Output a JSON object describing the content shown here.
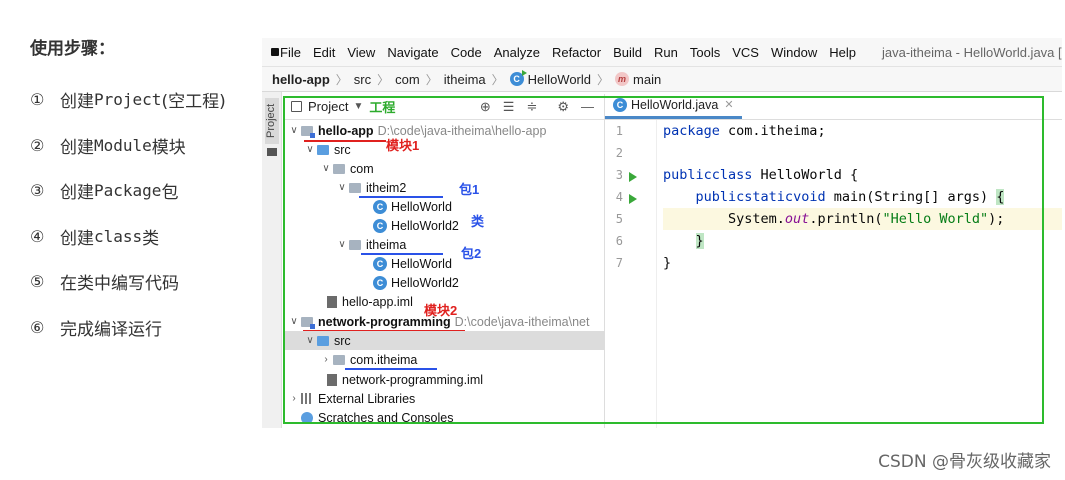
{
  "notes": {
    "title": "使用步骤：",
    "steps": [
      {
        "num": "①",
        "pre": "创建",
        "code": "Project",
        "post": " (空工程)"
      },
      {
        "num": "②",
        "pre": "创建",
        "code": "Module",
        "post": "模块"
      },
      {
        "num": "③",
        "pre": "创建",
        "code": "Package",
        "post": "包"
      },
      {
        "num": "④",
        "pre": "创建",
        "code": "class",
        "post": " 类"
      },
      {
        "num": "⑤",
        "pre": "在类中编写代码",
        "code": "",
        "post": ""
      },
      {
        "num": "⑥",
        "pre": "完成编译运行",
        "code": "",
        "post": ""
      }
    ]
  },
  "menu": {
    "items": [
      "File",
      "Edit",
      "View",
      "Navigate",
      "Code",
      "Analyze",
      "Refactor",
      "Build",
      "Run",
      "Tools",
      "VCS",
      "Window",
      "Help"
    ],
    "window_title": "java-itheima - HelloWorld.java [h"
  },
  "breadcrumb": [
    "hello-app",
    "src",
    "com",
    "itheima",
    "HelloWorld",
    "main"
  ],
  "project_panel": {
    "title": "Project",
    "annotation": "工程",
    "rows": [
      {
        "label": "hello-app",
        "path": "D:\\code\\java-itheima\\hello-app"
      },
      {
        "label": "src"
      },
      {
        "label": "com"
      },
      {
        "label": "itheim2"
      },
      {
        "label": "HelloWorld"
      },
      {
        "label": "HelloWorld2"
      },
      {
        "label": "itheima"
      },
      {
        "label": "HelloWorld"
      },
      {
        "label": "HelloWorld2"
      },
      {
        "label": "hello-app.iml"
      },
      {
        "label": "network-programming",
        "path": "D:\\code\\java-itheima\\net"
      },
      {
        "label": "src"
      },
      {
        "label": "com.itheima"
      },
      {
        "label": "network-programming.iml"
      },
      {
        "label": "External Libraries"
      },
      {
        "label": "Scratches and Consoles"
      }
    ],
    "annotations": {
      "module1": "模块1",
      "package1": "包1",
      "class": "类",
      "package2": "包2",
      "module2": "模块2"
    }
  },
  "editor": {
    "tab": "HelloWorld.java",
    "line_numbers": [
      "1",
      "2",
      "3",
      "4",
      "5",
      "6",
      "7"
    ],
    "code": {
      "l1_kw": "package",
      "l1_rest": " com.itheima;",
      "l3_kw1": "public",
      "l3_kw2": "class",
      "l3_rest": " HelloWorld {",
      "l4_indent": "    ",
      "l4_kw1": "public",
      "l4_kw2": "static",
      "l4_kw3": "void",
      "l4_rest": " main(String[] args) ",
      "l4_brace": "{",
      "l5_pre": "        System.",
      "l5_out": "out",
      "l5_mid": ".println(",
      "l5_str": "\"Hello World\"",
      "l5_post": ");",
      "l6_indent": "    ",
      "l6_brace": "}",
      "l7": "}"
    }
  },
  "watermark": "CSDN @骨灰级收藏家",
  "colors": {
    "frame_green": "#2dbb2d",
    "annotation_red": "#e0211f",
    "annotation_blue": "#2a52e8",
    "keyword": "#0033b3",
    "string": "#067d17"
  }
}
